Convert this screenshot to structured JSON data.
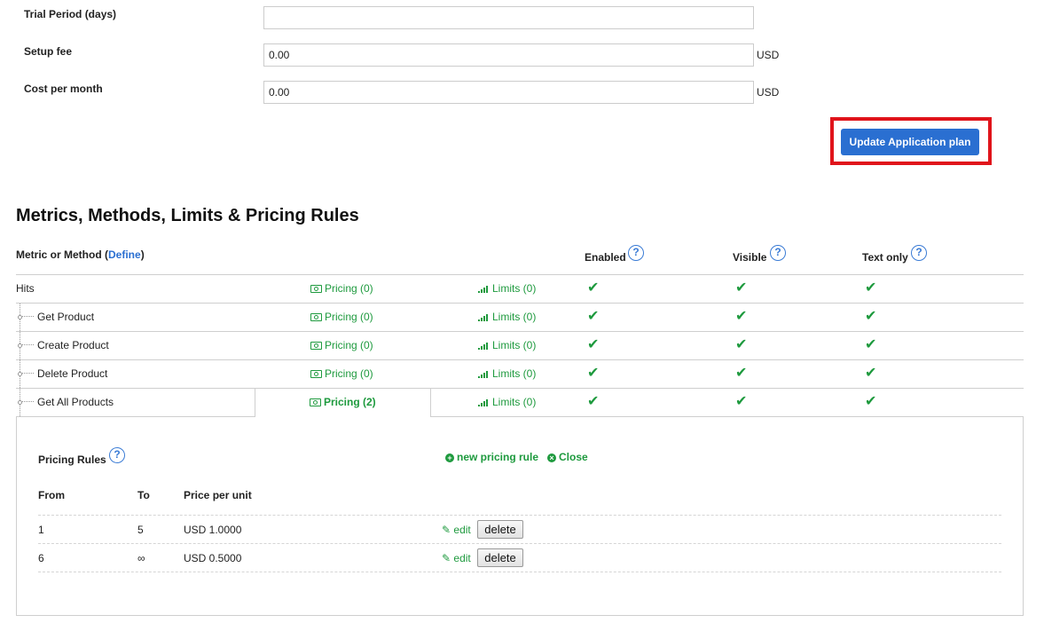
{
  "form": {
    "trial_label": "Trial Period (days)",
    "trial_value": "",
    "setup_label": "Setup fee",
    "setup_value": "0.00",
    "setup_unit": "USD",
    "cost_label": "Cost per month",
    "cost_value": "0.00",
    "cost_unit": "USD",
    "update_button": "Update Application plan"
  },
  "section": {
    "title": "Metrics, Methods, Limits & Pricing Rules"
  },
  "table": {
    "header_metric": "Metric or Method (",
    "header_define": "Define",
    "header_close_paren": ")",
    "header_enabled": "Enabled",
    "header_visible": "Visible",
    "header_text_only": "Text only",
    "help_glyph": "?",
    "check_glyph": "✔",
    "rows": [
      {
        "name": "Hits",
        "pricing": "Pricing (0)",
        "limits": "Limits (0)"
      },
      {
        "name": "Get Product",
        "pricing": "Pricing (0)",
        "limits": "Limits (0)"
      },
      {
        "name": "Create Product",
        "pricing": "Pricing (0)",
        "limits": "Limits (0)"
      },
      {
        "name": "Delete Product",
        "pricing": "Pricing (0)",
        "limits": "Limits (0)"
      },
      {
        "name": "Get All Products",
        "pricing": "Pricing (2)",
        "limits": "Limits (0)"
      }
    ]
  },
  "pricing_rules": {
    "title": "Pricing Rules",
    "new_rule": "new pricing rule",
    "close": "Close",
    "col_from": "From",
    "col_to": "To",
    "col_price": "Price per unit",
    "edit_label": "edit",
    "delete_label": "delete",
    "rules": [
      {
        "from": "1",
        "to": "5",
        "price": "USD 1.0000"
      },
      {
        "from": "6",
        "to": "∞",
        "price": "USD 0.5000"
      }
    ]
  },
  "colors": {
    "accent_blue": "#2a6fd1",
    "link_green": "#1e9a3e",
    "highlight_red": "#e0141b"
  }
}
